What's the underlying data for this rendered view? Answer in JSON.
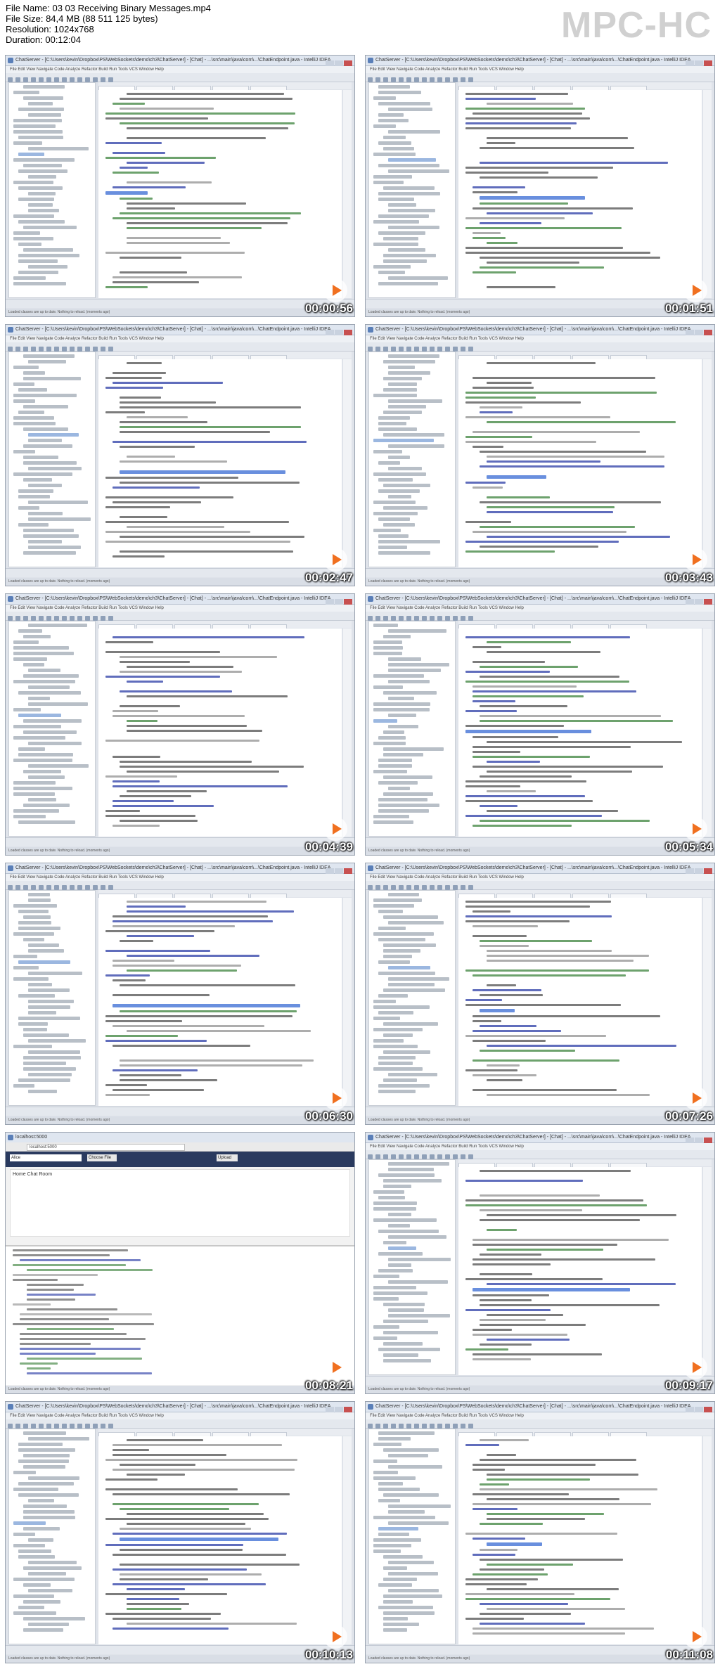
{
  "header": {
    "file_name": "File Name: 03 03 Receiving Binary Messages.mp4",
    "file_size": "File Size: 84,4 MB (88 511 125 bytes)",
    "resolution": "Resolution: 1024x768",
    "duration": "Duration: 00:12:04",
    "logo": "MPC-HC"
  },
  "ide": {
    "window_title": "ChatServer - [C:\\Users\\kevin\\Dropbox\\PS\\WebSockets\\demo\\ch3\\ChatServer] - [Chat] - ...\\src\\main\\java\\com\\...\\ChatEndpoint.java - IntelliJ IDEA",
    "menu": "File  Edit  View  Navigate  Code  Analyze  Refactor  Build  Run  Tools  VCS  Window  Help",
    "status": "Loaded classes are up to date. Nothing to reload. (moments ago)"
  },
  "browser": {
    "url": "localhost:5000",
    "name_value": "Alice",
    "choose_file": "Choose File",
    "upload": "Upload",
    "heading": "Home Chat Room"
  },
  "thumbnails": [
    {
      "timestamp": "00:00:56",
      "kind": "ide"
    },
    {
      "timestamp": "00:01:51",
      "kind": "ide"
    },
    {
      "timestamp": "00:02:47",
      "kind": "ide"
    },
    {
      "timestamp": "00:03:43",
      "kind": "ide"
    },
    {
      "timestamp": "00:04:39",
      "kind": "ide"
    },
    {
      "timestamp": "00:05:34",
      "kind": "ide"
    },
    {
      "timestamp": "00:06:30",
      "kind": "ide"
    },
    {
      "timestamp": "00:07:26",
      "kind": "ide"
    },
    {
      "timestamp": "00:08:21",
      "kind": "browser"
    },
    {
      "timestamp": "00:09:17",
      "kind": "ide"
    },
    {
      "timestamp": "00:10:13",
      "kind": "ide"
    },
    {
      "timestamp": "00:11:08",
      "kind": "ide"
    }
  ],
  "colors": {
    "code_keyword": "#1d2fa0",
    "code_string": "#2f7a2f",
    "code_plain": "#444444",
    "code_comment": "#8a8a8a",
    "highlight": "#2a5fd0",
    "play_accent": "#f07020"
  }
}
